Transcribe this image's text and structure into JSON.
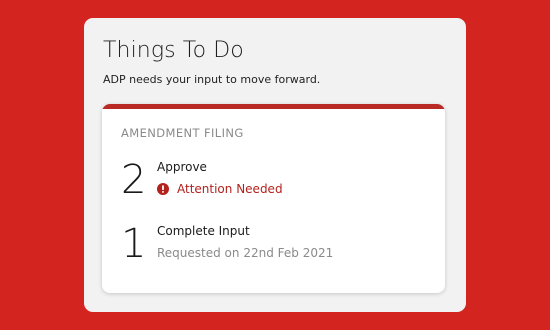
{
  "panel": {
    "title": "Things To Do",
    "subtitle": "ADP needs your input to move forward."
  },
  "card": {
    "title": "AMENDMENT FILING",
    "accent_color": "#b92a25",
    "tasks": [
      {
        "count": "2",
        "name": "Approve",
        "status": "Attention Needed",
        "status_icon": "alert-circle-icon",
        "status_color": "#b3211d"
      },
      {
        "count": "1",
        "name": "Complete Input",
        "status": "Requested on 22nd Feb 2021"
      }
    ]
  },
  "colors": {
    "background": "#d32420",
    "panel": "#f2f2f2",
    "card": "#ffffff"
  }
}
